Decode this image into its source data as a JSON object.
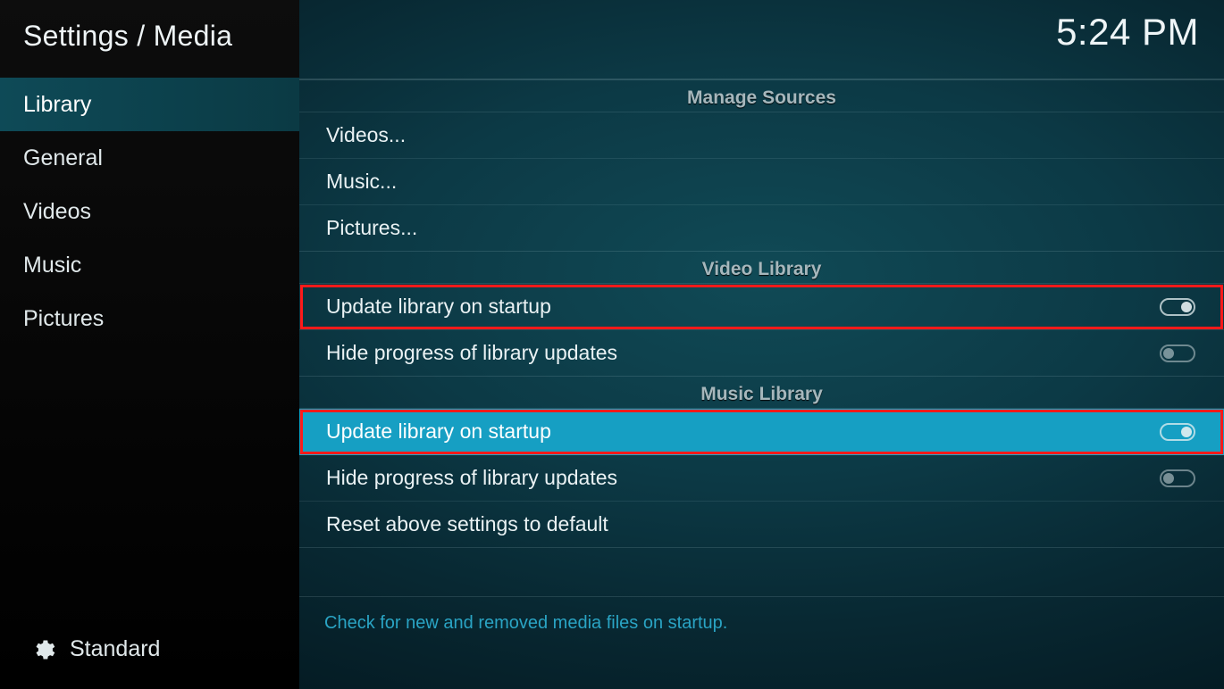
{
  "breadcrumb": "Settings / Media",
  "clock": "5:24 PM",
  "sidebar": {
    "items": [
      {
        "label": "Library",
        "selected": true
      },
      {
        "label": "General",
        "selected": false
      },
      {
        "label": "Videos",
        "selected": false
      },
      {
        "label": "Music",
        "selected": false
      },
      {
        "label": "Pictures",
        "selected": false
      }
    ],
    "level_label": "Standard"
  },
  "sections": {
    "manage_sources": {
      "header": "Manage Sources",
      "items": [
        {
          "label": "Videos..."
        },
        {
          "label": "Music..."
        },
        {
          "label": "Pictures..."
        }
      ]
    },
    "video_library": {
      "header": "Video Library",
      "items": [
        {
          "label": "Update library on startup",
          "toggle": true
        },
        {
          "label": "Hide progress of library updates",
          "toggle": false
        }
      ]
    },
    "music_library": {
      "header": "Music Library",
      "items": [
        {
          "label": "Update library on startup",
          "toggle": true
        },
        {
          "label": "Hide progress of library updates",
          "toggle": false
        },
        {
          "label": "Reset above settings to default"
        }
      ]
    }
  },
  "help_text": "Check for new and removed media files on startup."
}
